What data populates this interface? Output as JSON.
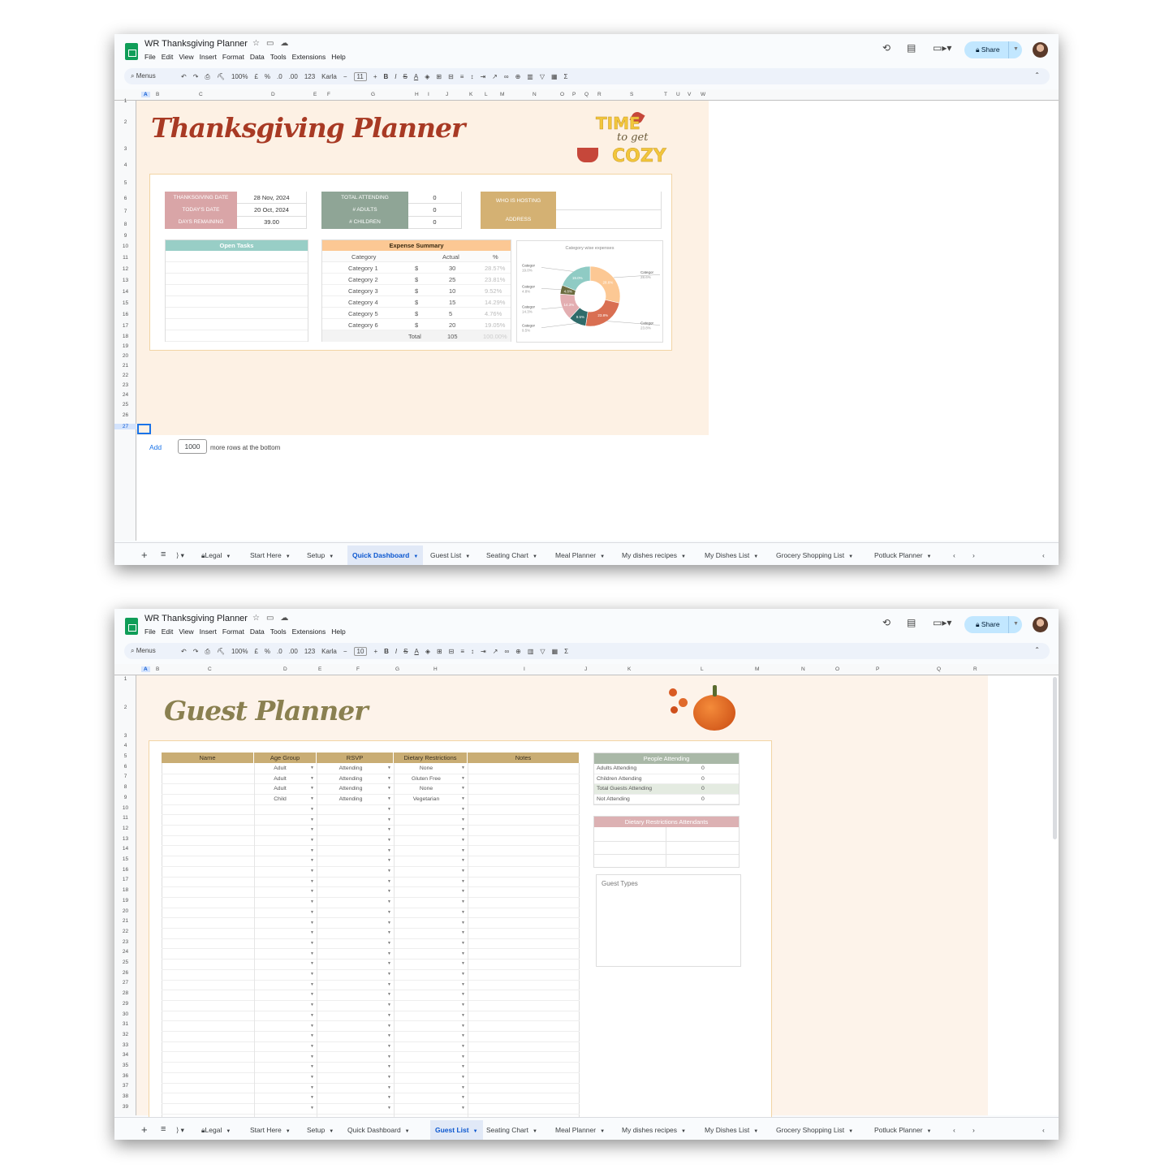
{
  "windows": [
    {
      "doc_title": "WR Thanksgiving Planner",
      "menu": [
        "File",
        "Edit",
        "View",
        "Insert",
        "Format",
        "Data",
        "Tools",
        "Extensions",
        "Help"
      ],
      "toolbar": {
        "menus": "Menus",
        "zoom": "100%",
        "currency": "£",
        "percent": "%",
        "dec_less": ".0",
        "dec_more": ".00",
        "format123": "123",
        "font": "Karla",
        "font_size": "11",
        "bold": "B",
        "italic": "I",
        "strike": "S",
        "textcolor": "A",
        "sigma": "Σ"
      },
      "share": "Share",
      "columns": [
        "A",
        "B",
        "C",
        "D",
        "E",
        "F",
        "G",
        "H",
        "I",
        "J",
        "K",
        "L",
        "M",
        "N",
        "O",
        "P",
        "Q",
        "R",
        "S",
        "T",
        "U",
        "V",
        "W"
      ],
      "rows": [
        "1",
        "2",
        "3",
        "4",
        "5",
        "6",
        "7",
        "8",
        "9",
        "10",
        "11",
        "12",
        "13",
        "14",
        "15",
        "16",
        "17",
        "18",
        "19",
        "20",
        "21",
        "22",
        "23",
        "24",
        "25",
        "26",
        "27"
      ],
      "title": "Thanksgiving Planner",
      "sticker": {
        "line1": "TIME",
        "line2": "to get",
        "line3": "COZY"
      },
      "info_left": [
        {
          "label": "THANKSGIVING DATE",
          "value": "28 Nov, 2024"
        },
        {
          "label": "TODAY'S DATE",
          "value": "20 Oct, 2024"
        },
        {
          "label": "DAYS REMAINING",
          "value": "39.00"
        }
      ],
      "info_mid": [
        {
          "label": "TOTAL ATTENDING",
          "value": "0"
        },
        {
          "label": "# ADULTS",
          "value": "0"
        },
        {
          "label": "# CHILDREN",
          "value": "0"
        }
      ],
      "info_right": [
        {
          "label": "WHO IS HOSTING",
          "value": ""
        },
        {
          "label": "ADDRESS",
          "value": ""
        }
      ],
      "open_tasks": "Open Tasks",
      "expense": {
        "title": "Expense Summary",
        "headers": [
          "Category",
          "Actual",
          "%"
        ],
        "rows": [
          {
            "cat": "Category 1",
            "cur": "$",
            "actual": "30",
            "pct": "28.57%"
          },
          {
            "cat": "Category 2",
            "cur": "$",
            "actual": "25",
            "pct": "23.81%"
          },
          {
            "cat": "Category 3",
            "cur": "$",
            "actual": "10",
            "pct": "9.52%"
          },
          {
            "cat": "Category 4",
            "cur": "$",
            "actual": "15",
            "pct": "14.29%"
          },
          {
            "cat": "Category 5",
            "cur": "$",
            "actual": "5",
            "pct": "4.76%"
          },
          {
            "cat": "Category 6",
            "cur": "$",
            "actual": "20",
            "pct": "19.05%"
          }
        ],
        "total_label": "Total",
        "total": "105",
        "total_pct": "100.00%"
      },
      "add_rows": {
        "add": "Add",
        "count": "1000",
        "suffix": "more rows at the bottom"
      },
      "tabs": [
        "Legal",
        "Start Here",
        "Setup",
        "Quick Dashboard",
        "Guest List",
        "Seating Chart",
        "Meal Planner",
        "My dishes recipes",
        "My Dishes List",
        "Grocery Shopping List",
        "Potluck Planner"
      ],
      "active_tab": "Quick Dashboard"
    },
    {
      "doc_title": "WR Thanksgiving Planner",
      "menu": [
        "File",
        "Edit",
        "View",
        "Insert",
        "Format",
        "Data",
        "Tools",
        "Extensions",
        "Help"
      ],
      "toolbar": {
        "menus": "Menus",
        "zoom": "100%",
        "currency": "£",
        "percent": "%",
        "dec_less": ".0",
        "dec_more": ".00",
        "format123": "123",
        "font": "Karla",
        "font_size": "10",
        "bold": "B",
        "italic": "I",
        "strike": "S",
        "textcolor": "A",
        "sigma": "Σ"
      },
      "share": "Share",
      "columns": [
        "A",
        "B",
        "C",
        "D",
        "E",
        "F",
        "G",
        "H",
        "I",
        "J",
        "K",
        "L",
        "M",
        "N",
        "O",
        "P",
        "Q",
        "R"
      ],
      "rows": [
        "1",
        "2",
        "3",
        "4",
        "5",
        "6",
        "7",
        "8",
        "9",
        "10",
        "11",
        "12",
        "13",
        "14",
        "15",
        "16",
        "17",
        "18",
        "19",
        "20",
        "21",
        "22",
        "23",
        "24",
        "25",
        "26",
        "27",
        "28",
        "29",
        "30",
        "31",
        "32",
        "33",
        "34",
        "35",
        "36",
        "37",
        "38",
        "39"
      ],
      "title": "Guest Planner",
      "guest_headers": [
        "Name",
        "Age Group",
        "RSVP",
        "Dietary Restrictions",
        "Notes"
      ],
      "guests": [
        {
          "age": "Adult",
          "rsvp": "Attending",
          "diet": "None"
        },
        {
          "age": "Adult",
          "rsvp": "Attending",
          "diet": "Gluten Free"
        },
        {
          "age": "Adult",
          "rsvp": "Attending",
          "diet": "None"
        },
        {
          "age": "Child",
          "rsvp": "Attending",
          "diet": "Vegetarian"
        }
      ],
      "people": {
        "title": "People Attending",
        "rows": [
          {
            "label": "Adults Attending",
            "value": "0"
          },
          {
            "label": "Children Attending",
            "value": "0"
          },
          {
            "label": "Total Guests Attending",
            "value": "0"
          },
          {
            "label": "Not Attending",
            "value": "0"
          }
        ]
      },
      "dietary_title": "Dietary Restrictions Attendants",
      "guest_types": "Guest Types",
      "tabs": [
        "Legal",
        "Start Here",
        "Setup",
        "Quick Dashboard",
        "Guest List",
        "Seating Chart",
        "Meal Planner",
        "My dishes recipes",
        "My Dishes List",
        "Grocery Shopping List",
        "Potluck Planner"
      ],
      "active_tab": "Guest List"
    }
  ],
  "chart_data": {
    "type": "pie",
    "title": "Category wise expenses",
    "donut": true,
    "labels": [
      "Category 1",
      "Category 2",
      "Category 3",
      "Category 4",
      "Category 5",
      "Category 6"
    ],
    "values": [
      28.6,
      23.8,
      9.5,
      14.3,
      4.8,
      19.0
    ],
    "slice_labels": [
      "28.6%",
      "23.8%",
      "9.5%",
      "14.3%",
      "4.8%",
      "19.0%"
    ],
    "callouts": [
      {
        "name": "Categor",
        "pct": "28.6%"
      },
      {
        "name": "Categor",
        "pct": "23.8%"
      },
      {
        "name": "Categor",
        "pct": "9.5%"
      },
      {
        "name": "Categor",
        "pct": "14.3%"
      },
      {
        "name": "Categor",
        "pct": "4.8%"
      },
      {
        "name": "Categor",
        "pct": "19.0%"
      }
    ],
    "colors": [
      "#fcc894",
      "#d96f52",
      "#2f6b6a",
      "#e3aeb1",
      "#6b6b3e",
      "#8fcbc4"
    ],
    "legend": "callouts"
  },
  "colors": {
    "accent": "#0b57d0",
    "share_bg": "#c2e7ff",
    "label_pink": "#d9a5a7",
    "label_sage": "#8fa596",
    "label_gold": "#d4b173",
    "teal_header": "#98cec6",
    "peach_header": "#fcc894",
    "guest_header": "#c9ad74",
    "title_red": "#a83a24",
    "title_olive": "#8a8050"
  }
}
